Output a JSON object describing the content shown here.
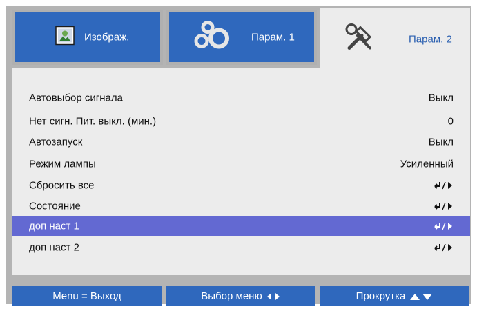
{
  "tabs": [
    {
      "label": "Изображ.",
      "icon": "picture-icon"
    },
    {
      "label": "Парам. 1",
      "icon": "gears-icon"
    },
    {
      "label": "Парам. 2",
      "icon": "tools-icon",
      "active": true
    }
  ],
  "menu": {
    "items": [
      {
        "label": "Автовыбор сигнала",
        "value": "Выкл"
      },
      {
        "label": "Нет сигн. Пит. выкл. (мин.)",
        "value": "0"
      },
      {
        "label": "Автозапуск",
        "value": "Выкл"
      },
      {
        "label": "Режим лампы",
        "value": "Усиленный"
      },
      {
        "label": "Сбросить все",
        "value_icon": "enter-arrow-icon"
      },
      {
        "label": "Состояние",
        "value_icon": "enter-arrow-icon"
      },
      {
        "label": "доп наст 1",
        "value_icon": "enter-arrow-icon",
        "selected": true
      },
      {
        "label": "доп наст 2",
        "value_icon": "enter-arrow-icon"
      }
    ]
  },
  "footer": {
    "exit": "Menu = Выход",
    "select": "Выбор меню",
    "scroll": "Прокрутка"
  },
  "colors": {
    "tab_blue": "#2f68bd",
    "frame_gray": "#b4b4b4",
    "panel_bg": "#ececec",
    "selected_row": "#6369d2"
  }
}
